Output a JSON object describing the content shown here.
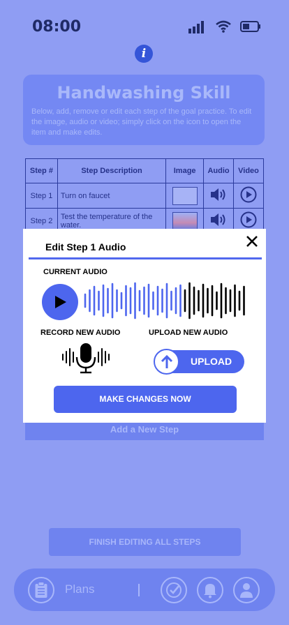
{
  "status_bar": {
    "time": "08:00"
  },
  "header": {
    "title": "Handwashing Skill",
    "description": "Below, add, remove or edit each step of the goal practice. To edit the image, audio or video; simply click on the icon to open the item and make edits."
  },
  "table": {
    "columns": [
      "Step #",
      "Step Description",
      "Image",
      "Audio",
      "Video"
    ],
    "rows": [
      {
        "step": "Step 1",
        "description": "Turn on faucet"
      },
      {
        "step": "Step 2",
        "description": "Test the temperature of the water."
      }
    ]
  },
  "add_step_label": "Add a New Step",
  "finish_label": "FINISH EDITING ALL STEPS",
  "nav": {
    "plans_label": "Plans"
  },
  "modal": {
    "title": "Edit Step 1 Audio",
    "current_audio_label": "CURRENT AUDIO",
    "record_label": "RECORD NEW AUDIO",
    "upload_label": "UPLOAD NEW AUDIO",
    "upload_button": "UPLOAD",
    "make_changes_button": "MAKE CHANGES NOW"
  },
  "colors": {
    "background": "#8f9df3",
    "accent": "#4d66ee",
    "dark_text": "#26328a"
  }
}
